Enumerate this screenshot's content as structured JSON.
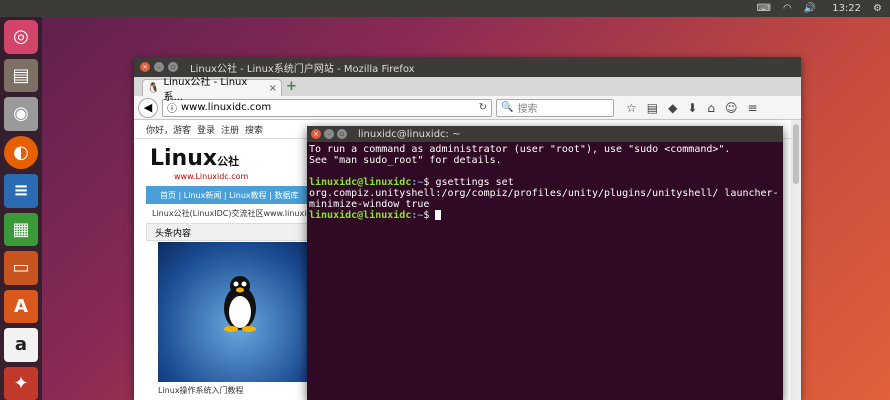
{
  "top_panel": {
    "clock": "13:22",
    "icons": [
      "keyboard-icon",
      "wifi-icon",
      "volume-icon",
      "power-icon"
    ]
  },
  "launcher": {
    "items": [
      "ubuntu-dash",
      "files",
      "disks",
      "firefox",
      "libreoffice-writer",
      "libreoffice-calc",
      "libreoffice-impress",
      "ubuntu-software",
      "amazon",
      "system-settings"
    ]
  },
  "firefox": {
    "title": "Linux公社 - Linux系统门户网站 - Mozilla Firefox",
    "tab_label": "Linux公社 - Linux系...",
    "url": "www.linuxidc.com",
    "search_placeholder": "搜索",
    "page": {
      "top_links": [
        "你好，游客",
        "登录",
        "注册",
        "搜索"
      ],
      "logo_text": "Linux",
      "logo_cn": "公社",
      "logo_sub": "www.Linuxidc.com",
      "nav_text": "首页 | Linux新闻 | Linux教程 | 数据库",
      "breadcrumb": "Linux公社(LinuxIDC)交流社区www.linuxidc",
      "headline": "头条内容",
      "caption": "Linux操作系统入门教程"
    }
  },
  "terminal": {
    "title": "linuxidc@linuxidc: ~",
    "line1": "To run a command as administrator (user \"root\"), use \"sudo <command>\".",
    "line2": "See \"man sudo_root\" for details.",
    "prompt_user": "linuxidc@linuxidc",
    "prompt_path": ":~",
    "prompt_sym": "$ ",
    "command": "gsettings set org.compiz.unityshell:/org/compiz/profiles/unity/plugins/unityshell/ launcher-minimize-window true"
  }
}
